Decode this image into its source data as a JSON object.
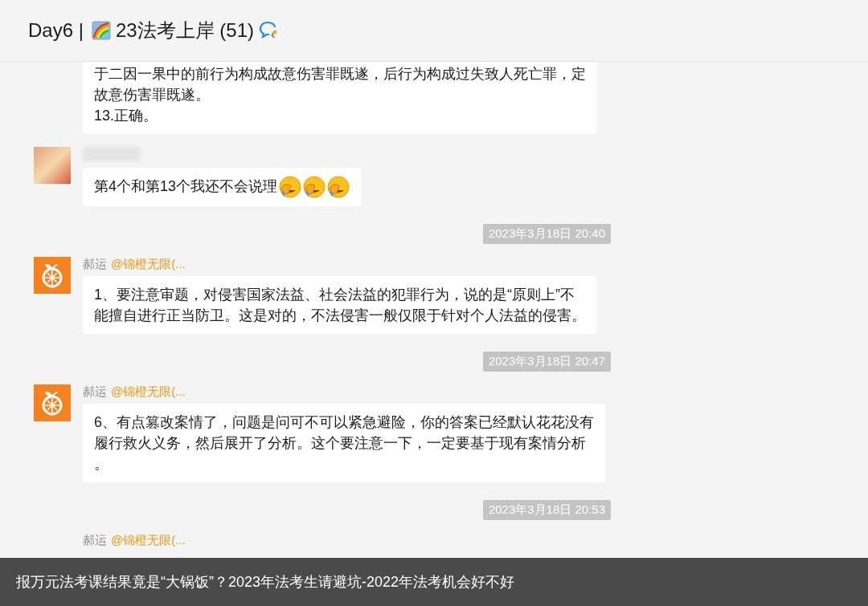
{
  "header": {
    "prefix": "Day6 |",
    "title": "23法考上岸 (51)"
  },
  "messages": [
    {
      "kind": "message",
      "lines": [
        "于二因一果中的前行为构成故意伤害罪既遂，后行为构成过失致人死亡罪，定",
        "故意伤害罪既遂。",
        "13.正确。"
      ]
    },
    {
      "kind": "message",
      "avatar": {
        "kind": "photo"
      },
      "name_blurred": true,
      "lines": [
        "第4个和第13个我还不会说理"
      ],
      "emoji": [
        {
          "kind": "facepalm"
        },
        {
          "kind": "facepalm"
        },
        {
          "kind": "facepalm"
        }
      ]
    },
    {
      "kind": "time",
      "text": "2023年3月18日 20:40"
    },
    {
      "kind": "message",
      "avatar": {
        "kind": "orange"
      },
      "name": "郝运",
      "mention": "@锦橙无限(...",
      "lines": [
        "1、要注意审题，对侵害国家法益、社会法益的犯罪行为，说的是“原则上”不",
        "能擅自进行正当防卫。这是对的，不法侵害一般仅限于针对个人法益的侵害。"
      ]
    },
    {
      "kind": "time",
      "text": "2023年3月18日 20:47"
    },
    {
      "kind": "message",
      "avatar": {
        "kind": "orange"
      },
      "name": "郝运",
      "mention": "@锦橙无限(...",
      "lines": [
        "6、有点篡改案情了，问题是问可不可以紧急避险，你的答案已经默认花花没有",
        "履行救火义务，然后展开了分析。这个要注意一下，一定要基于现有案情分析",
        "。"
      ]
    },
    {
      "kind": "time",
      "text": "2023年3月18日 20:53"
    },
    {
      "kind": "message",
      "name": "郝运",
      "mention": "@锦橙无限(..."
    }
  ],
  "caption": "报万元法考课结果竟是“大锅饭”？2023年法考生请避坑-2022年法考机会好不好"
}
